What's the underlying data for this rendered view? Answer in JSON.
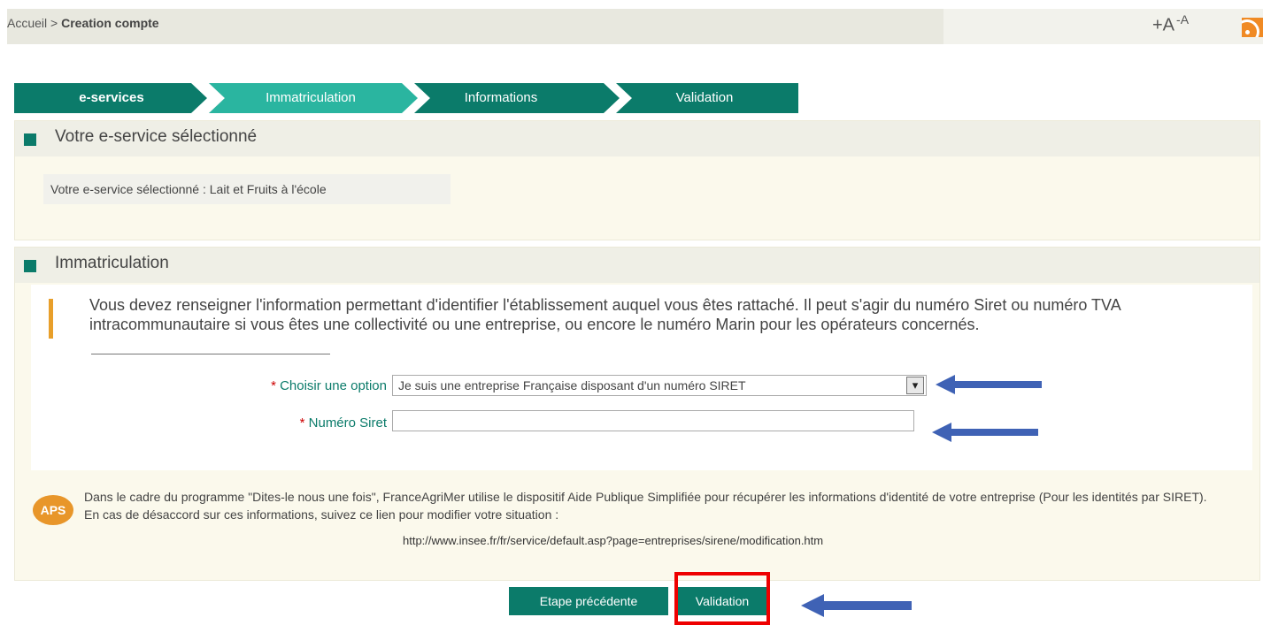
{
  "breadcrumb": {
    "home": "Accueil",
    "separator": ">",
    "current": "Creation compte"
  },
  "font_controls": {
    "increase": "+A",
    "decrease": "-A"
  },
  "steps": [
    "e-services",
    "Immatriculation",
    "Informations",
    "Validation"
  ],
  "panel_selected": {
    "title": "Votre e-service sélectionné",
    "text": "Votre e-service sélectionné : Lait et Fruits à l'école"
  },
  "panel_immatriculation": {
    "title": "Immatriculation",
    "info": "Vous devez renseigner l'information permettant d'identifier l'établissement auquel vous êtes rattaché. Il peut s'agir du numéro Siret ou numéro TVA intracommunautaire si vous êtes une collectivité ou une entreprise, ou encore le numéro Marin pour les opérateurs concernés.",
    "option_label": "Choisir une option",
    "option_value": "Je suis une entreprise Française disposant d'un numéro SIRET",
    "siret_label": "Numéro Siret",
    "siret_value": "",
    "required_mark": "*"
  },
  "aps": {
    "badge": "APS",
    "text": "Dans le cadre du programme \"Dites-le nous une fois\", FranceAgriMer utilise le dispositif Aide Publique Simplifiée pour récupérer les informations d'identité de votre entreprise (Pour les identités par SIRET). En cas de désaccord sur ces informations, suivez ce lien pour modifier votre situation :",
    "link": "http://www.insee.fr/fr/service/default.asp?page=entreprises/sirene/modification.htm"
  },
  "buttons": {
    "previous": "Etape précédente",
    "validate": "Validation"
  },
  "colors": {
    "accent": "#0b7b6a",
    "active_step": "#2ab5a0",
    "annotation_red": "#ee0000",
    "annotation_arrow": "#3f62b5"
  }
}
